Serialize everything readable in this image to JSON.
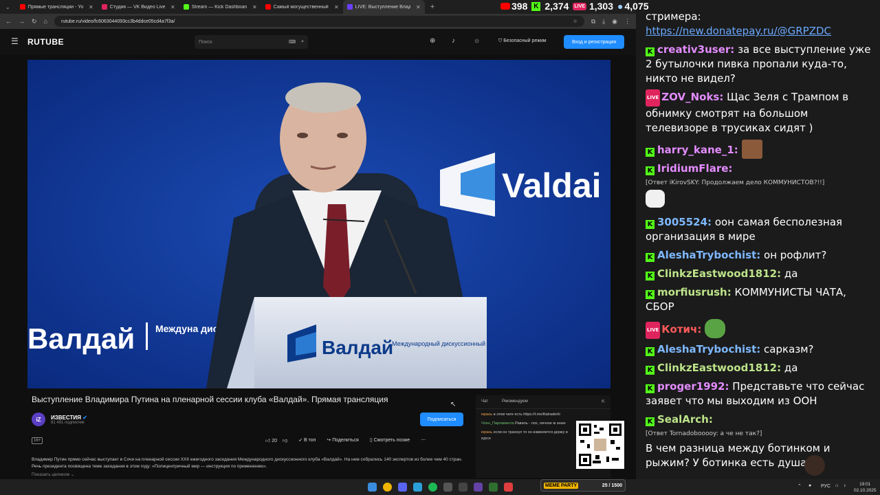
{
  "browser": {
    "tabs": [
      {
        "title": "Прямые трансляции - YouTube",
        "color": "#ff0000"
      },
      {
        "title": "Студия — VK Видео Live",
        "color": "#e0245e"
      },
      {
        "title": "Stream — Kick Dashboard",
        "color": "#53fc18"
      },
      {
        "title": "Самый могущественный человек",
        "color": "#ff0000"
      },
      {
        "title": "LIVE: Выступление Владимира",
        "color": "#6b3fff"
      }
    ],
    "url": "rutube.ru/video/fc6063044093cc3b4ddce05cd4a7f3a/"
  },
  "stats": {
    "youtube": "398",
    "kick": "2,374",
    "vk": "1,303",
    "total": "4,075"
  },
  "rutube": {
    "logo": "RUTUBE",
    "search_placeholder": "Поиск",
    "safe_mode": "Безопасный режим",
    "login": "Вход и регистрация",
    "video_title": "Выступление Владимира Путина на пленарной сессии клуба «Валдай». Прямая трансляция",
    "channel": "ИЗВЕСТИЯ",
    "subscribers": "81 491 подписчик",
    "subscribe": "Подписаться",
    "age": "16+",
    "likes": "20",
    "top": "В топ",
    "share": "Поделиться",
    "watch_later": "Смотреть позже",
    "description": "Владимир Путин прямо сейчас выступает в Сочи на пленарной сессии XXII ежегодного заседания Международного дискуссионного клуба «Валдай». На нем собрались 140 экспертов из более чем 40 стран. Речь президента посвящена теме заседания в этом году: «Полицентричный мир — инструкция по применению».",
    "show_all": "Показать целиком",
    "chat_tab": "Чат",
    "recommend_tab": "Рекомендуем",
    "valdai_en": "Valdai",
    "valdai_ru": "Валдай",
    "valdai_sub": "Международный дискуссионный клуб",
    "valdai_side": "Междуна дискусс"
  },
  "mini_chat": [
    {
      "user": "юрань",
      "text": "в этом чате есть https://t.me/iliatraderiii"
    },
    {
      "user": "Член_Парламента",
      "text": "Равиль - лох, личное м знаю"
    },
    {
      "user": "юрань",
      "text": "если он трахнул то он извиняется держу в курсе"
    }
  ],
  "stream_chat": [
    {
      "text": "стримера:",
      "platform": ""
    },
    {
      "text": "https://new.donatepay.ru/@GRPZDC",
      "platform": ""
    },
    {
      "user": "creativ3user:",
      "text": "за все выступление уже 2 бутылочки пивка пропали куда-то, никто не видел?",
      "platform": "kick",
      "color": "#e38cff"
    },
    {
      "user": "ZOV_Noks:",
      "text": "Щас Зеля с Трампом в обнимку смотрят на большом телевизоре в трусиках сидят )",
      "platform": "vk",
      "color": "#e38cff"
    },
    {
      "user": "harry_kane_1:",
      "text": "",
      "platform": "kick",
      "color": "#e38cff"
    },
    {
      "user": "IridiumFlare:",
      "text": "",
      "platform": "kick",
      "color": "#e38cff",
      "reply": "[Ответ iKirovSKY: Продолжаем дело КОММУНИСТОВ?!!]"
    },
    {
      "user": "3005524:",
      "text": "оон самая бесполезная организация в мире",
      "platform": "kick",
      "color": "#7eb8ff"
    },
    {
      "user": "AleshaTrybochist:",
      "text": "он рофлит?",
      "platform": "kick",
      "color": "#7eb8ff"
    },
    {
      "user": "ClinkzEastwood1812:",
      "text": "да",
      "platform": "kick",
      "color": "#bde48a"
    },
    {
      "user": "morfiusrush:",
      "text": "КОММУНИСТЫ ЧАТА, СБОР",
      "platform": "kick",
      "color": "#bde48a"
    },
    {
      "user": "Котич:",
      "text": "",
      "platform": "vk",
      "color": "#ff5a5a"
    },
    {
      "user": "AleshaTrybochist:",
      "text": "сарказм?",
      "platform": "kick",
      "color": "#7eb8ff"
    },
    {
      "user": "ClinkzEastwood1812:",
      "text": "да",
      "platform": "kick",
      "color": "#bde48a"
    },
    {
      "user": "proger1992:",
      "text": "Представьте что сейчас заявет что мы выходим из ООН",
      "platform": "kick",
      "color": "#e38cff"
    },
    {
      "user": "SealArch:",
      "text": "",
      "platform": "kick",
      "color": "#bde48a",
      "reply": "[Ответ Tornadobooooy: а че не так?]"
    },
    {
      "text": "В чем разница между ботинком и рыжим? У ботинка есть душа",
      "platform": ""
    }
  ],
  "taskbar": {
    "lang": "РУС",
    "time": "19:01",
    "date": "02.10.2025",
    "overlay": "MEME PARTY",
    "counter": "25 / 1500"
  }
}
